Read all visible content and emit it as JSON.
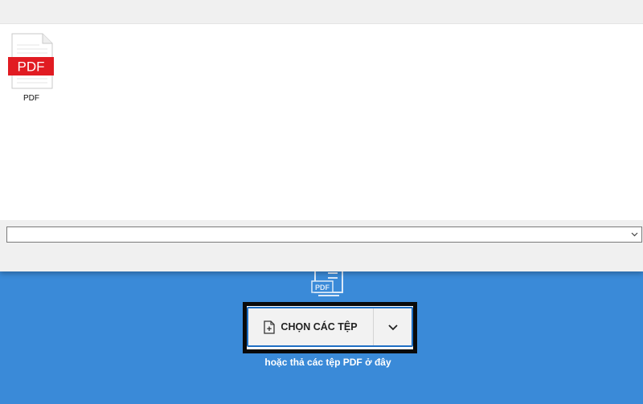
{
  "dialog": {
    "files": [
      {
        "name": "PDF",
        "badge": "PDF",
        "icon": "pdf-file-icon"
      }
    ],
    "filename_label": "",
    "filename_value": "",
    "filename_placeholder": ""
  },
  "upload": {
    "choose_button_label": "CHỌN CÁC TỆP",
    "drop_hint": "hoặc thả các tệp PDF ở đây",
    "illustration_label": "PDF"
  },
  "colors": {
    "upload_background": "#3a8ad8",
    "button_background": "#f2f2f2",
    "pdf_badge_red": "#e11b22",
    "highlight_border": "#0a0a0a"
  }
}
